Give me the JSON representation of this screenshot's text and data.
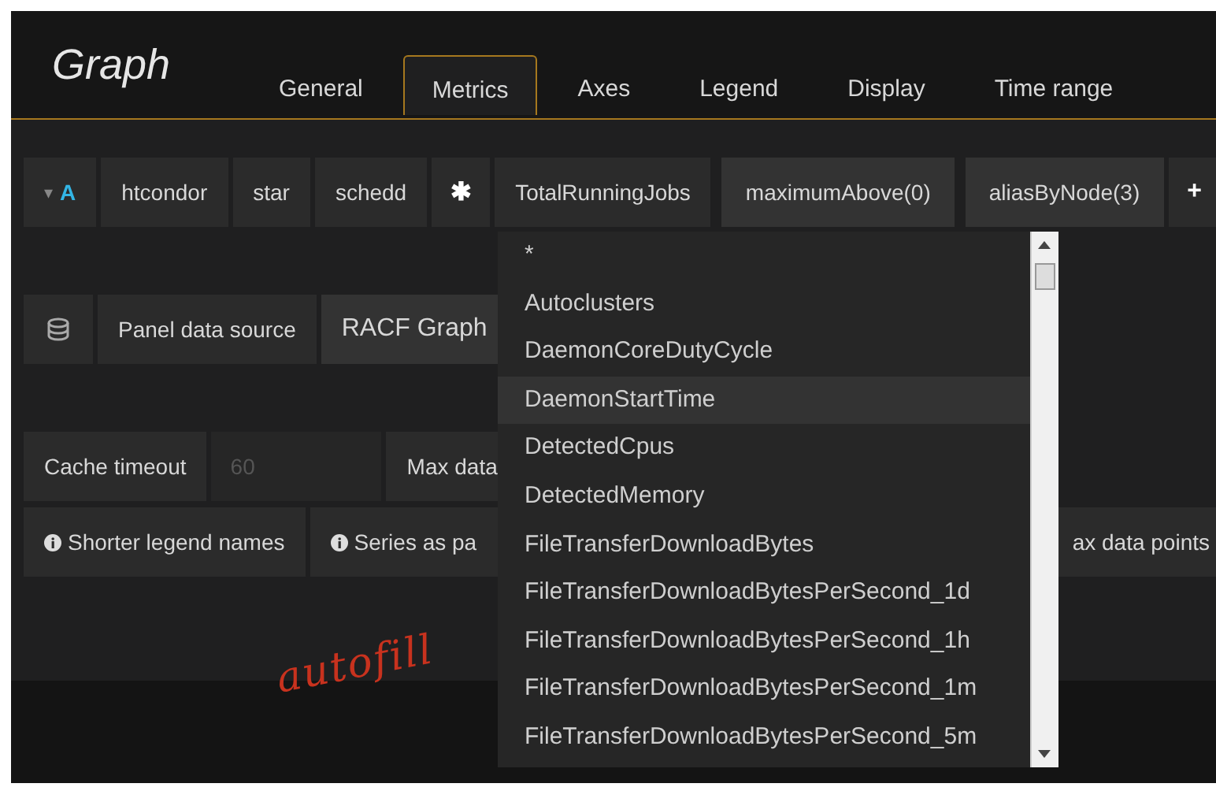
{
  "header": {
    "title": "Graph",
    "tabs": [
      {
        "label": "General",
        "selected": false
      },
      {
        "label": "Metrics",
        "selected": true
      },
      {
        "label": "Axes",
        "selected": false
      },
      {
        "label": "Legend",
        "selected": false
      },
      {
        "label": "Display",
        "selected": false
      },
      {
        "label": "Time range",
        "selected": false
      }
    ]
  },
  "query": {
    "toggle": "▾",
    "letter": "A",
    "segments": [
      {
        "text": "htcondor",
        "kind": "text"
      },
      {
        "text": "star",
        "kind": "text"
      },
      {
        "text": "schedd",
        "kind": "text"
      },
      {
        "text": "✱",
        "kind": "symbol"
      },
      {
        "text": "TotalRunningJobs",
        "kind": "text"
      },
      {
        "text": "maximumAbove(0)",
        "kind": "function"
      },
      {
        "text": "aliasByNode(3)",
        "kind": "function"
      },
      {
        "text": "+",
        "kind": "symbol"
      }
    ]
  },
  "datasource": {
    "label": "Panel data source",
    "value": "RACF Graph"
  },
  "options": {
    "cache_label": "Cache timeout",
    "cache_placeholder": "60",
    "max_label": "Max data",
    "chips": [
      "Shorter legend names",
      "Series as pa"
    ],
    "right_chip": "ax data points"
  },
  "annotation": "autofill",
  "dropdown": {
    "items": [
      {
        "text": "*",
        "selected": false
      },
      {
        "text": "Autoclusters",
        "selected": false
      },
      {
        "text": "DaemonCoreDutyCycle",
        "selected": false
      },
      {
        "text": "DaemonStartTime",
        "selected": true
      },
      {
        "text": "DetectedCpus",
        "selected": false
      },
      {
        "text": "DetectedMemory",
        "selected": false
      },
      {
        "text": "FileTransferDownloadBytes",
        "selected": false
      },
      {
        "text": "FileTransferDownloadBytesPerSecond_1d",
        "selected": false
      },
      {
        "text": "FileTransferDownloadBytesPerSecond_1h",
        "selected": false
      },
      {
        "text": "FileTransferDownloadBytesPerSecond_1m",
        "selected": false
      },
      {
        "text": "FileTransferDownloadBytesPerSecond_5m",
        "selected": false
      }
    ]
  }
}
